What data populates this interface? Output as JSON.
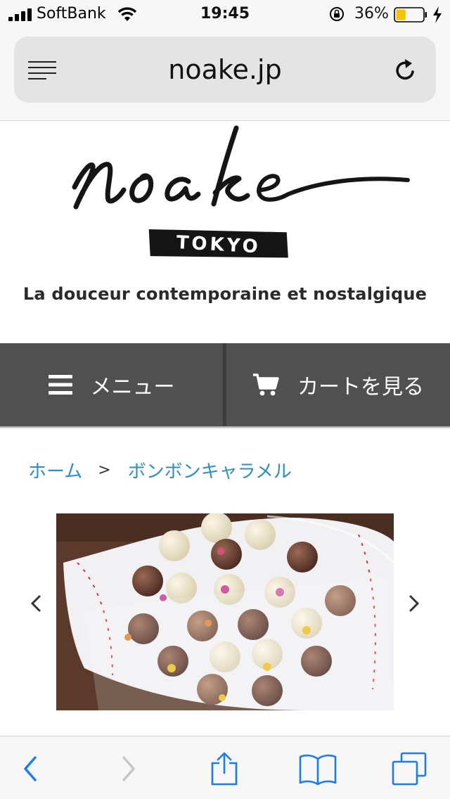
{
  "status_bar": {
    "carrier": "SoftBank",
    "time": "19:45",
    "battery_percent": "36%",
    "battery_level": 0.36,
    "icons": [
      "signal-icon",
      "wifi-icon",
      "rotation-lock-icon",
      "battery-icon",
      "charging-icon"
    ]
  },
  "browser": {
    "url": "noake.jp",
    "icons": [
      "reader-mode-icon",
      "reload-icon"
    ]
  },
  "logo": {
    "text": "noake",
    "sub": "TOKYO",
    "tagline": "La douceur contemporaine et nostalgique"
  },
  "nav": {
    "menu_label": "メニュー",
    "cart_label": "カートを見る",
    "icons": [
      "hamburger-menu-icon",
      "shopping-cart-icon"
    ]
  },
  "breadcrumb": {
    "home": "ホーム",
    "separator": ">",
    "current": "ボンボンキャラメル"
  },
  "gallery": {
    "icons": [
      "chevron-left-icon",
      "chevron-right-icon"
    ]
  },
  "toolbar": {
    "icons": [
      "back-icon",
      "forward-icon",
      "share-icon",
      "bookmarks-icon",
      "tabs-icon"
    ]
  },
  "colors": {
    "accent_link": "#2a8ecf",
    "nav_button": "#505050",
    "toolbar_icon": "#1a7cf5",
    "battery_fill": "#f5c400"
  }
}
